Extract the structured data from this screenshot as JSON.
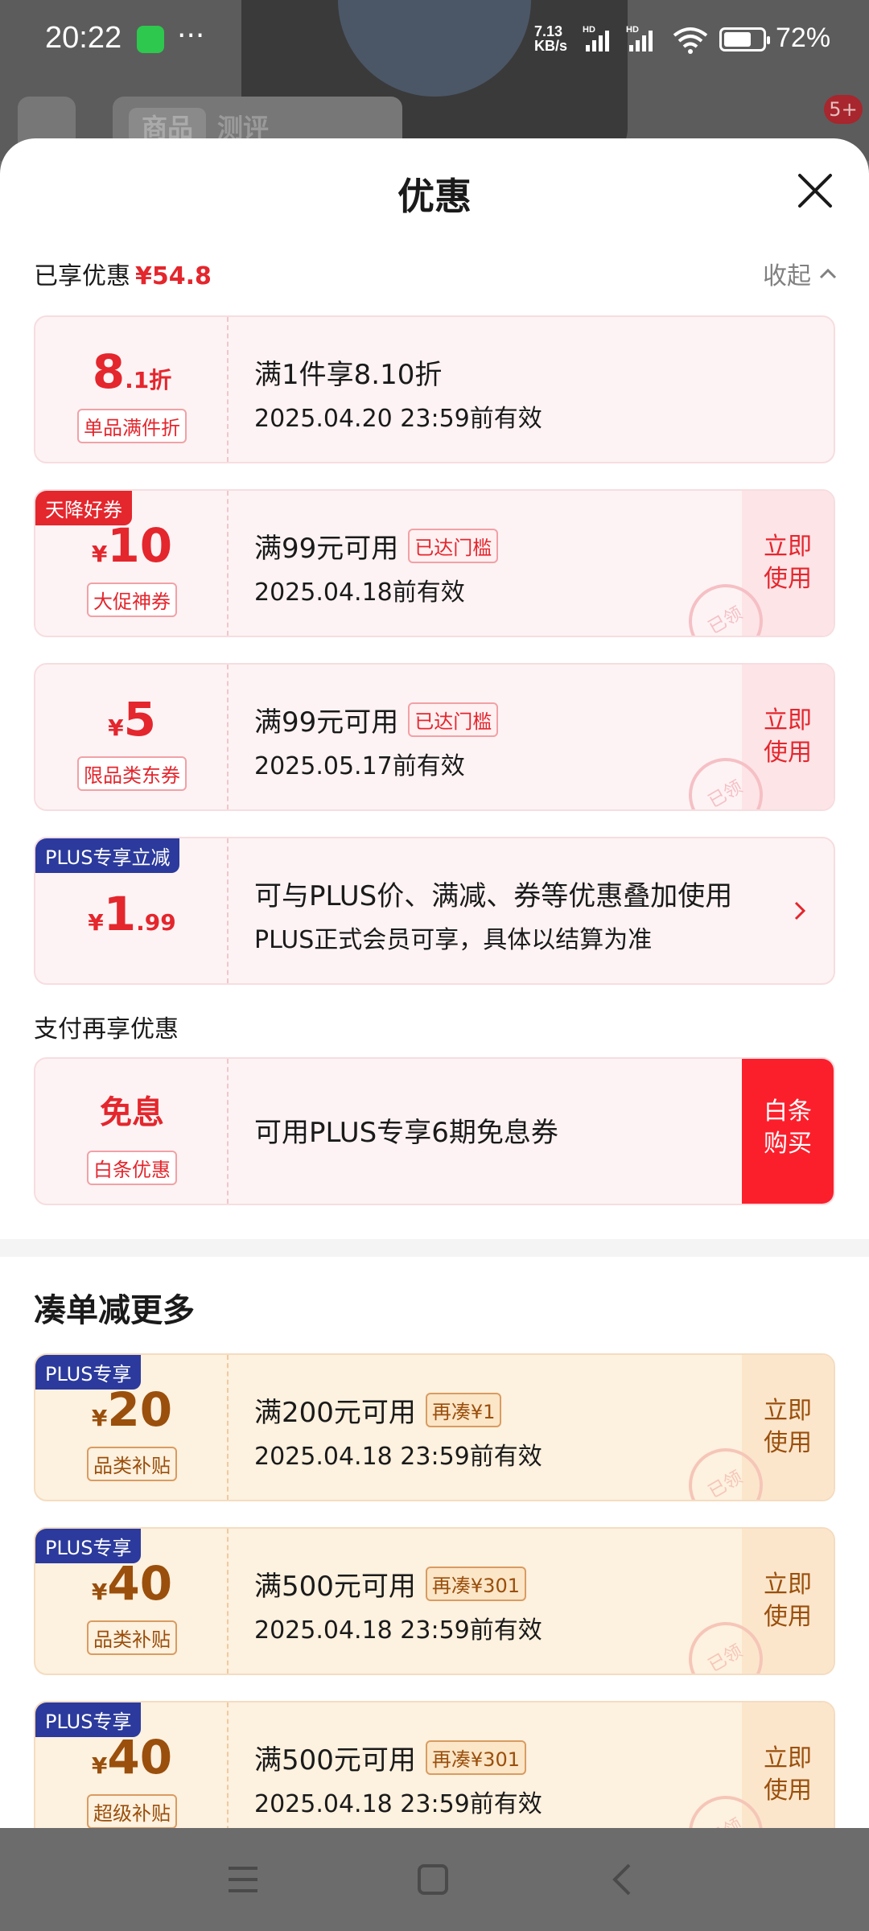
{
  "status_bar": {
    "time": "20:22",
    "net_speed": "7.13\nKB/s",
    "battery": "72%",
    "battery_level": 0.72
  },
  "background": {
    "tabs": [
      "商品",
      "测评"
    ],
    "cart_badge": "5+"
  },
  "sheet": {
    "title": "优惠",
    "enjoyed_label": "已享优惠",
    "enjoyed_amount": "¥54.8",
    "collapse_label": "收起"
  },
  "coupons": [
    {
      "amount_big": "8",
      "amount_small": ".1折",
      "sub": "单品满件折",
      "line1": "满1件享8.10折",
      "line2": "2025.04.20 23:59前有效"
    },
    {
      "badge": "天降好券",
      "yen": "¥",
      "amount_big": "10",
      "sub": "大促神券",
      "line1": "满99元可用",
      "tag": "已达门槛",
      "line2": "2025.04.18前有效",
      "action": "立即\n使用",
      "stamp": "已领"
    },
    {
      "yen": "¥",
      "amount_big": "5",
      "sub": "限品类东券",
      "line1": "满99元可用",
      "tag": "已达门槛",
      "line2": "2025.05.17前有效",
      "action": "立即\n使用",
      "stamp": "已领"
    },
    {
      "badge": "PLUS专享立减",
      "yen": "¥",
      "amount_big": "1",
      "amount_small": ".99",
      "line1": "可与PLUS价、满减、券等优惠叠加使用",
      "line2": "PLUS正式会员可享，具体以结算为准"
    }
  ],
  "pay_section": {
    "label": "支付再享优惠",
    "title": "免息",
    "sub": "白条优惠",
    "line1": "可用PLUS专享6期免息券",
    "action": "白条\n购买"
  },
  "more": {
    "title": "凑单减更多",
    "coupons": [
      {
        "badge": "PLUS专享",
        "yen": "¥",
        "amount_big": "20",
        "sub": "品类补贴",
        "line1": "满200元可用",
        "tag": "再凑¥1",
        "line2": "2025.04.18 23:59前有效",
        "action": "立即\n使用",
        "stamp": "已领"
      },
      {
        "badge": "PLUS专享",
        "yen": "¥",
        "amount_big": "40",
        "sub": "品类补贴",
        "line1": "满500元可用",
        "tag": "再凑¥301",
        "line2": "2025.04.18 23:59前有效",
        "action": "立即\n使用",
        "stamp": "已领"
      },
      {
        "badge": "PLUS专享",
        "yen": "¥",
        "amount_big": "40",
        "sub": "超级补贴",
        "line1": "满500元可用",
        "tag": "再凑¥301",
        "line2": "2025.04.18 23:59前有效",
        "action": "立即\n使用",
        "stamp": "已领"
      }
    ]
  },
  "icons": {
    "close": "close-icon",
    "collapse": "chevron-up-icon",
    "arrow": "chevron-right-icon",
    "nav": [
      "menu-icon",
      "home-icon",
      "back-icon"
    ]
  },
  "colors": {
    "accent_red": "#e4262d",
    "pay_button": "#fb1f2c",
    "plus_badge": "#2b3a9c",
    "gold_text": "#9a4f0c"
  }
}
